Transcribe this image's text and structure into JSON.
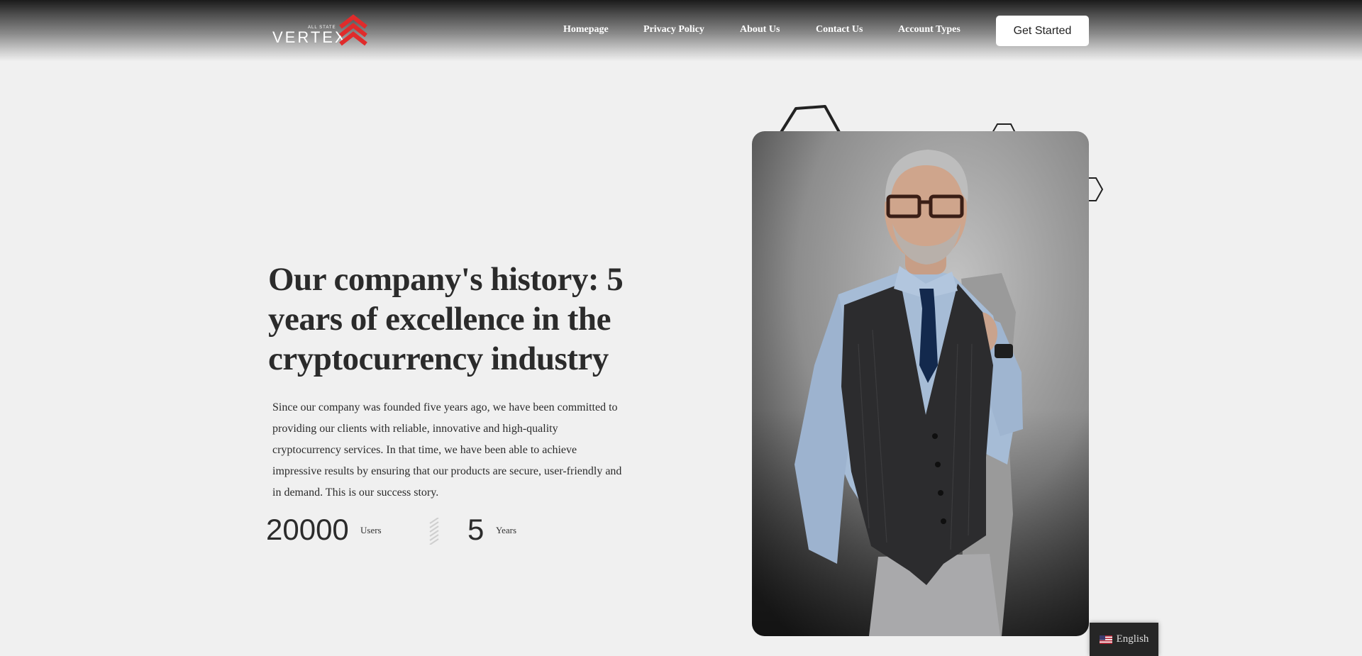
{
  "header": {
    "logo": {
      "small_text": "ALL STATE",
      "big_text": "VERTEX",
      "accent": "#e02b2b"
    },
    "nav": [
      {
        "label": "Homepage"
      },
      {
        "label": "Privacy Policy"
      },
      {
        "label": "About Us"
      },
      {
        "label": "Contact Us"
      },
      {
        "label": "Account Types"
      }
    ],
    "cta_label": "Get Started"
  },
  "hero": {
    "title": "Our company's history: 5 years of excellence in the cryptocurrency industry",
    "paragraph": "Since our company was founded five years ago, we have been committed to providing our clients with reliable, innovative and high-quality cryptocurrency services. In that time, we have been able to achieve impressive results by ensuring that our products are secure, user-friendly and in demand. This is our success story.",
    "stats": [
      {
        "value": "20000",
        "label": "Users"
      },
      {
        "value": "5",
        "label": "Years"
      }
    ]
  },
  "language_switcher": {
    "label": "English",
    "flag_icon": "us-flag-icon"
  },
  "colors": {
    "background": "#f0f0f0",
    "text": "#2b2b2b",
    "accent": "#e02b2b"
  }
}
